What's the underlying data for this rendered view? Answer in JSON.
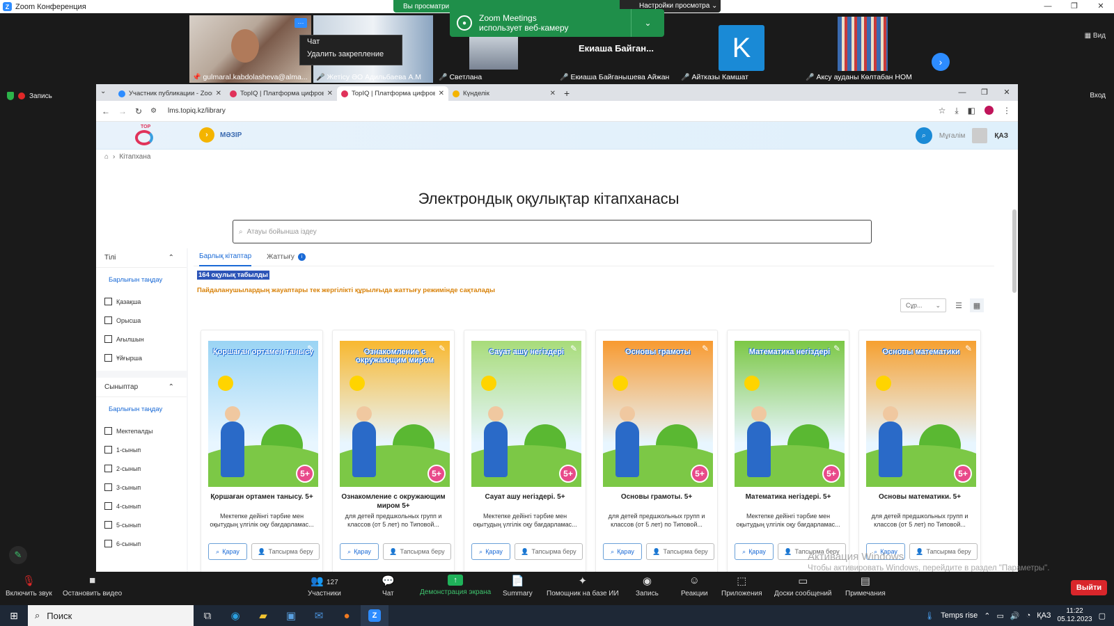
{
  "zoom": {
    "title": "Zoom Конференция",
    "share_banner": {
      "text": "Вы просматри",
      "options": "Настройки просмотра"
    },
    "notification": {
      "line1": "Zoom Meetings",
      "line2": "использует веб-камеру"
    },
    "context_menu": [
      "Чат",
      "Удалить закрепление"
    ],
    "view_label": "Вид",
    "record_label": "Запись",
    "login_label": "Вход",
    "participants": [
      {
        "name": "gulmaral.kabdolasheva@alma..."
      },
      {
        "name": "Жетісу ӘО Адильбаева А.М"
      },
      {
        "name": "Светлана"
      },
      {
        "name": "Екиаша Байганышева Айжан",
        "big": "Екиаша  Байган..."
      },
      {
        "name": "Айтказы Камшат",
        "initial": "K"
      },
      {
        "name": "Аксу ауданы Көлтабан НОМ"
      }
    ],
    "toolbar": {
      "mic": "Включить звук",
      "video": "Остановить видео",
      "participants": "Участники",
      "participants_count": "127",
      "chat": "Чат",
      "share": "Демонстрация экрана",
      "summary": "Summary",
      "ai": "Помощник на базе ИИ",
      "record": "Запись",
      "reactions": "Реакции",
      "apps": "Приложения",
      "boards": "Доски сообщений",
      "notes": "Примечания",
      "leave": "Выйти"
    }
  },
  "browser": {
    "tabs": [
      {
        "label": "Участник публикации - Zoom",
        "color": "#2d8cff"
      },
      {
        "label": "TopIQ | Платформа цифрово",
        "color": "#e0325a"
      },
      {
        "label": "TopIQ | Платформа цифрово",
        "color": "#e0325a",
        "active": true
      },
      {
        "label": "Күнделік",
        "color": "#f4b400"
      }
    ],
    "url": "lms.topiq.kz/library"
  },
  "site": {
    "logo_text": "TOP",
    "mezir": "МӘЗІР",
    "user": "Мұғалім",
    "lang": "ҚАЗ",
    "breadcrumb": "Кітапхана",
    "page_title": "Электрондық оқулықтар кітапханасы",
    "search_placeholder": "Атауы бойынша іздеу",
    "sidebar": {
      "lang_head": "Тілі",
      "select_all": "Барлығын таңдау",
      "langs": [
        "Қазақша",
        "Орысша",
        "Ағылшын",
        "Ұйғырша"
      ],
      "class_head": "Сыныптар",
      "classes": [
        "Мектепалды",
        "1-сынып",
        "2-сынып",
        "3-сынып",
        "4-сынып",
        "5-сынып",
        "6-сынып"
      ]
    },
    "tabs": {
      "all": "Барлық кітаптар",
      "practice": "Жаттығу"
    },
    "found": "164 оқулық табылды",
    "warning": "Пайдаланушылардың жауаптары тек жергілікті құрылғыда жаттығу режимінде сақталады",
    "sort": "Сұр...",
    "btn_view": "Қарау",
    "btn_assign": "Тапсырма беру",
    "books": [
      {
        "cover": "Қоршаған ортамен танысу",
        "title": "Қоршаған ортамен танысу. 5+",
        "desc": "Мектепке дейінгі тәрбие мен оқытудың үлгілік оқу бағдарламас...",
        "bg": "#9ad4f4"
      },
      {
        "cover": "Ознакомление с окружающим миром",
        "title": "Ознакомление с окружающим миром 5+",
        "desc": "для детей предшкольных групп и классов (от 5 лет) по Типовой...",
        "bg": "#f8b830"
      },
      {
        "cover": "Сауат ашу негіздері",
        "title": "Сауат ашу негіздері. 5+",
        "desc": "Мектепке дейінгі тәрбие мен оқытудың үлгілік оқу бағдарламас...",
        "bg": "#a8dc7a"
      },
      {
        "cover": "Основы грамоты",
        "title": "Основы грамоты. 5+",
        "desc": "для детей предшкольных групп и классов (от 5 лет) по Типовой...",
        "bg": "#f89a30"
      },
      {
        "cover": "Математика негіздері",
        "title": "Математика негіздері. 5+",
        "desc": "Мектепке дейінгі тәрбие мен оқытудың үлгілік оқу бағдарламас...",
        "bg": "#7cc846"
      },
      {
        "cover": "Основы математики",
        "title": "Основы математики. 5+",
        "desc": "для детей предшкольных групп и классов (от 5 лет) по Типовой...",
        "bg": "#f6a030"
      }
    ]
  },
  "windows": {
    "watermark1": "Активация Windows",
    "watermark2": "Чтобы активировать Windows, перейдите в раздел \"Параметры\".",
    "search": "Поиск",
    "weather": "Temps rise",
    "lang": "ҚАЗ",
    "time": "11:22",
    "date": "05.12.2023"
  }
}
